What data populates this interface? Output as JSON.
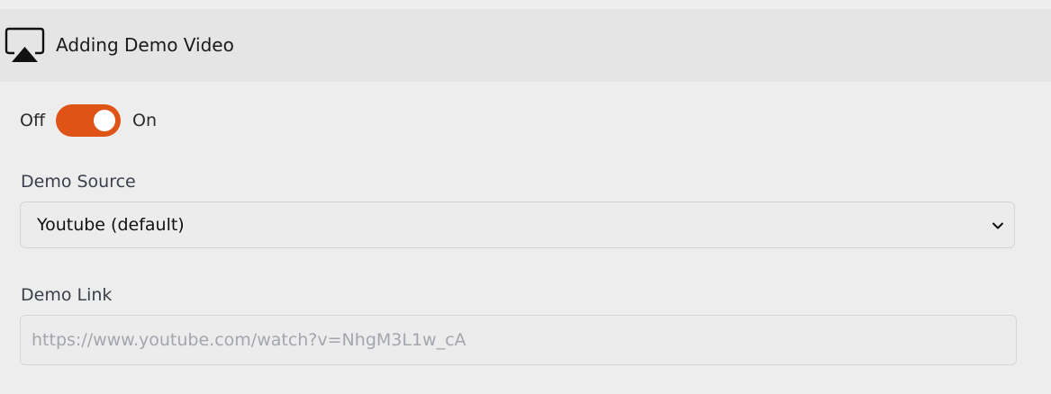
{
  "section": {
    "icon": "airplay-icon",
    "title": "Adding Demo Video"
  },
  "toggle": {
    "off_label": "Off",
    "on_label": "On",
    "state": "on",
    "accent_color": "#e05316"
  },
  "demo_source": {
    "label": "Demo Source",
    "selected": "Youtube (default)"
  },
  "demo_link": {
    "label": "Demo Link",
    "value": "",
    "placeholder": "https://www.youtube.com/watch?v=NhgM3L1w_cA"
  }
}
